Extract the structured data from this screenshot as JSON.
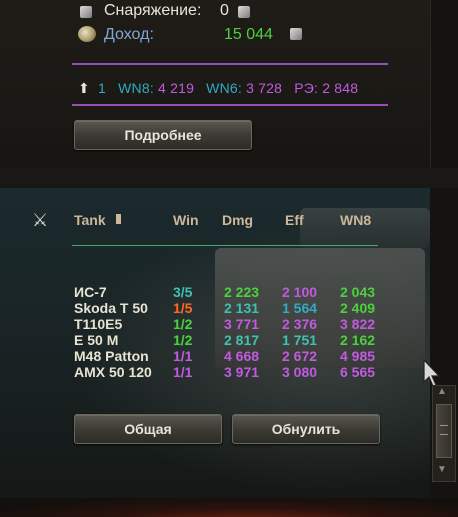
{
  "summary": {
    "equipment_label": "Снаряжение:",
    "equipment_value": "0",
    "income_label": "Доход:",
    "income_value": "15 044"
  },
  "ratings": {
    "rank": "1",
    "wn8_label": "WN8:",
    "wn8_value": "4 219",
    "wn6_label": "WN6:",
    "wn6_value": "3 728",
    "re_label": "РЭ:",
    "re_value": "2 848"
  },
  "buttons": {
    "details": "Подробнее",
    "overall": "Общая",
    "reset": "Обнулить"
  },
  "session_table": {
    "headers": {
      "tank": "Tank",
      "win": "Win",
      "dmg": "Dmg",
      "eff": "Eff",
      "wn8": "WN8"
    },
    "rows": [
      {
        "tank": "ИС-7",
        "win": "3/5",
        "dmg": "2 223",
        "eff": "2 100",
        "wn8": "2 043"
      },
      {
        "tank": "Skoda T 50",
        "win": "1/5",
        "dmg": "2 131",
        "eff": "1 564",
        "wn8": "2 409"
      },
      {
        "tank": "T110E5",
        "win": "1/2",
        "dmg": "3 771",
        "eff": "2 376",
        "wn8": "3 822"
      },
      {
        "tank": "E 50 M",
        "win": "1/2",
        "dmg": "2 817",
        "eff": "1 751",
        "wn8": "2 162"
      },
      {
        "tank": "M48 Patton",
        "win": "1/1",
        "dmg": "4 668",
        "eff": "2 672",
        "wn8": "4 985"
      },
      {
        "tank": "AMX 50 120",
        "win": "1/1",
        "dmg": "3 971",
        "eff": "3 080",
        "wn8": "6 565"
      }
    ]
  },
  "colors": {
    "green": "#4cd13f",
    "teal": "#3fc1b0",
    "cyan": "#33a9c4",
    "purple": "#c25ae0",
    "orange": "#ff6a1e",
    "header_text": "#cbb79a",
    "label_blue": "#7fa7d6"
  }
}
